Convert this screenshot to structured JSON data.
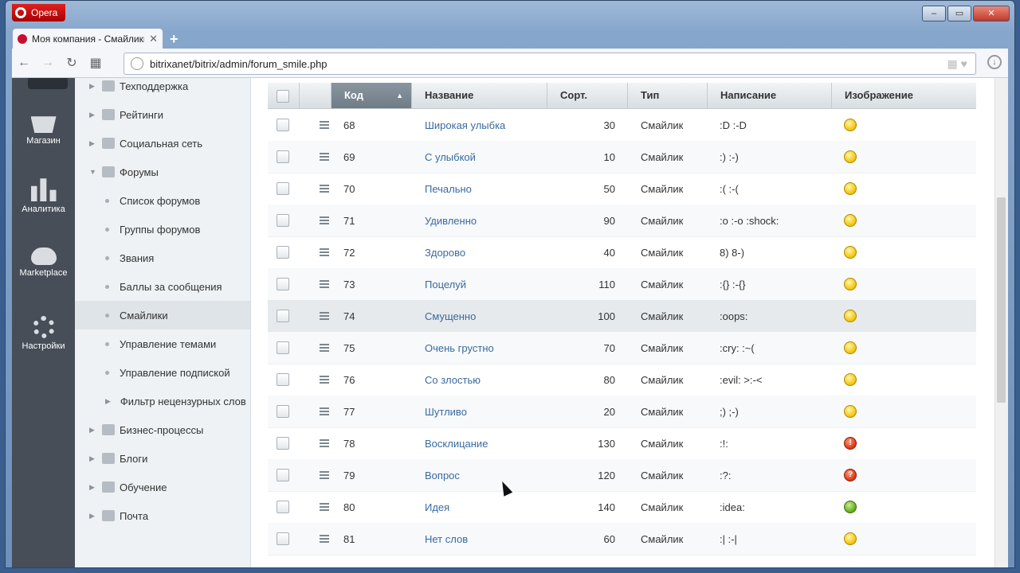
{
  "browser": {
    "name": "Opera",
    "tab_title": "Моя компания - Смайлики",
    "url": "bitrixanet/bitrix/admin/forum_smile.php",
    "window_controls": [
      "–",
      "▭",
      "✕"
    ]
  },
  "leftbar": {
    "items": [
      {
        "label": "Магазин",
        "icon": "basket-icon"
      },
      {
        "label": "Аналитика",
        "icon": "chart-icon"
      },
      {
        "label": "Marketplace",
        "icon": "cloud-download-icon"
      },
      {
        "label": "Настройки",
        "icon": "gear-icon"
      }
    ]
  },
  "menu": {
    "items": [
      {
        "label": "Техподдержка",
        "type": "top"
      },
      {
        "label": "Рейтинги",
        "type": "top"
      },
      {
        "label": "Социальная сеть",
        "type": "top"
      },
      {
        "label": "Форумы",
        "type": "top-open"
      },
      {
        "label": "Список форумов",
        "type": "sub"
      },
      {
        "label": "Группы форумов",
        "type": "sub"
      },
      {
        "label": "Звания",
        "type": "sub"
      },
      {
        "label": "Баллы за сообщения",
        "type": "sub"
      },
      {
        "label": "Смайлики",
        "type": "sub-active"
      },
      {
        "label": "Управление темами",
        "type": "sub"
      },
      {
        "label": "Управление подпиской",
        "type": "sub"
      },
      {
        "label": "Фильтр нецензурных слов",
        "type": "sub-arrow"
      },
      {
        "label": "Бизнес-процессы",
        "type": "top"
      },
      {
        "label": "Блоги",
        "type": "top"
      },
      {
        "label": "Обучение",
        "type": "top"
      },
      {
        "label": "Почта",
        "type": "top"
      }
    ]
  },
  "grid": {
    "columns": {
      "code": "Код",
      "name": "Название",
      "sort": "Сорт.",
      "type": "Тип",
      "typing": "Написание",
      "image": "Изображение"
    },
    "rows": [
      {
        "code": "68",
        "name": "Широкая улыбка",
        "sort": "30",
        "type": "Смайлик",
        "typing": ":D :-D",
        "image": "smile"
      },
      {
        "code": "69",
        "name": "С улыбкой",
        "sort": "10",
        "type": "Смайлик",
        "typing": ":) :-)",
        "image": "smile"
      },
      {
        "code": "70",
        "name": "Печально",
        "sort": "50",
        "type": "Смайлик",
        "typing": ":( :-(",
        "image": "smile"
      },
      {
        "code": "71",
        "name": "Удивленно",
        "sort": "90",
        "type": "Смайлик",
        "typing": ":o :-o :shock:",
        "image": "smile"
      },
      {
        "code": "72",
        "name": "Здорово",
        "sort": "40",
        "type": "Смайлик",
        "typing": "8) 8-)",
        "image": "smile"
      },
      {
        "code": "73",
        "name": "Поцелуй",
        "sort": "110",
        "type": "Смайлик",
        "typing": ":{} :-{}",
        "image": "smile"
      },
      {
        "code": "74",
        "name": "Смущенно",
        "sort": "100",
        "type": "Смайлик",
        "typing": ":oops:",
        "image": "smile"
      },
      {
        "code": "75",
        "name": "Очень грустно",
        "sort": "70",
        "type": "Смайлик",
        "typing": ":cry: :~(",
        "image": "smile"
      },
      {
        "code": "76",
        "name": "Со злостью",
        "sort": "80",
        "type": "Смайлик",
        "typing": ":evil: >:-<",
        "image": "smile"
      },
      {
        "code": "77",
        "name": "Шутливо",
        "sort": "20",
        "type": "Смайлик",
        "typing": ";) ;-)",
        "image": "smile"
      },
      {
        "code": "78",
        "name": "Восклицание",
        "sort": "130",
        "type": "Смайлик",
        "typing": ":!:",
        "image": "exclaim"
      },
      {
        "code": "79",
        "name": "Вопрос",
        "sort": "120",
        "type": "Смайлик",
        "typing": ":?:",
        "image": "question"
      },
      {
        "code": "80",
        "name": "Идея",
        "sort": "140",
        "type": "Смайлик",
        "typing": ":idea:",
        "image": "idea"
      },
      {
        "code": "81",
        "name": "Нет слов",
        "sort": "60",
        "type": "Смайлик",
        "typing": ":| :-|",
        "image": "smile"
      }
    ]
  }
}
